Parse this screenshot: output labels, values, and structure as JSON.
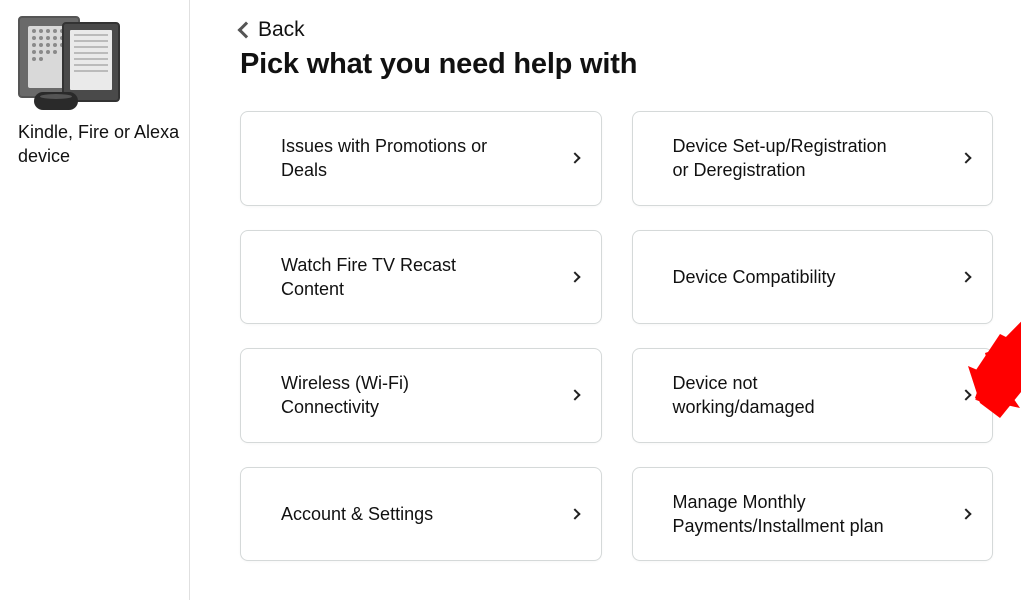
{
  "sidebar": {
    "device_label": "Kindle, Fire or Alexa device"
  },
  "nav": {
    "back_label": "Back"
  },
  "page": {
    "title": "Pick what you need help with"
  },
  "options": [
    {
      "label": "Issues with Promotions or Deals"
    },
    {
      "label": "Device Set-up/Registration or Deregistration"
    },
    {
      "label": "Watch Fire TV Recast Content"
    },
    {
      "label": "Device Compatibility"
    },
    {
      "label": "Wireless (Wi-Fi) Connectivity"
    },
    {
      "label": "Device not working/damaged"
    },
    {
      "label": "Account & Settings"
    },
    {
      "label": "Manage Monthly Payments/Installment plan"
    }
  ],
  "annotation": {
    "color": "#ff0000"
  }
}
